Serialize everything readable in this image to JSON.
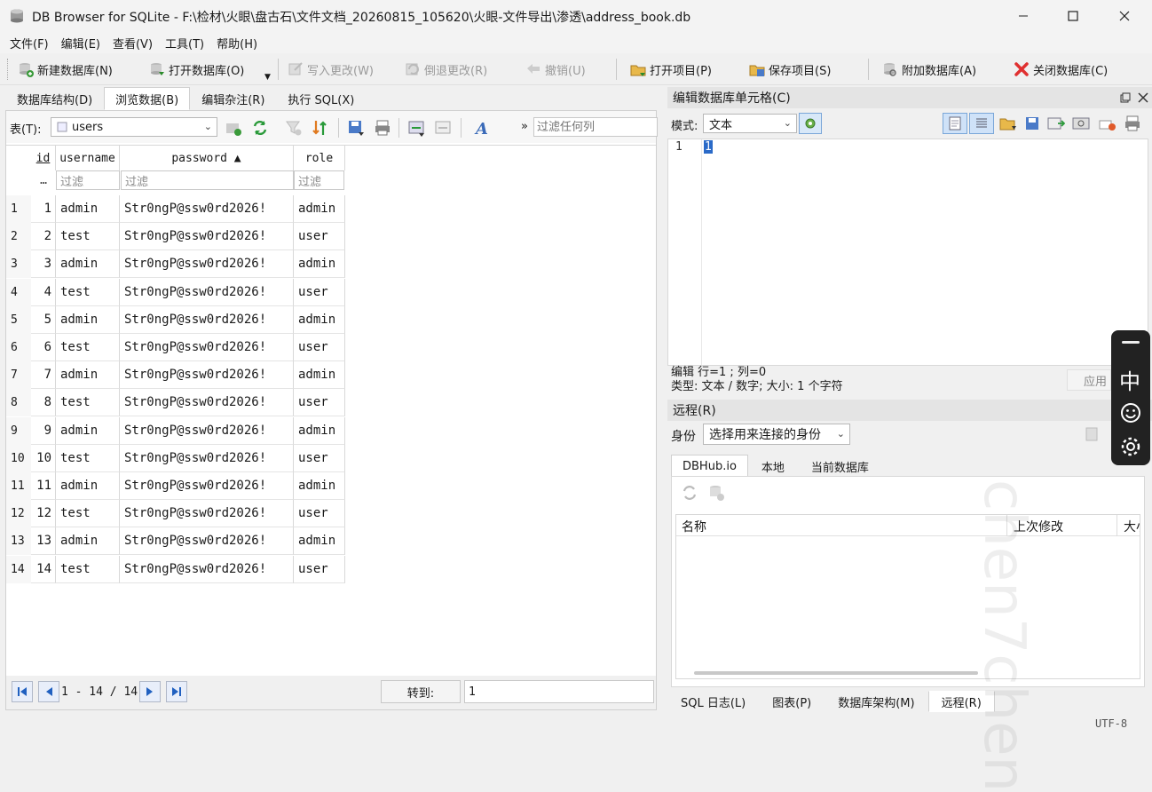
{
  "window": {
    "title": "DB Browser for SQLite - F:\\检材\\火眼\\盘古石\\文件文档_20260815_105620\\火眼-文件导出\\渗透\\address_book.db",
    "icon": "database-icon"
  },
  "menu": [
    "文件(F)",
    "编辑(E)",
    "查看(V)",
    "工具(T)",
    "帮助(H)"
  ],
  "toolbar": {
    "new_db": "新建数据库(N)",
    "open_db": "打开数据库(O)",
    "write_changes": "写入更改(W)",
    "revert_changes": "倒退更改(R)",
    "undo": "撤销(U)",
    "open_project": "打开项目(P)",
    "save_project": "保存项目(S)",
    "attach_db": "附加数据库(A)",
    "close_db": "关闭数据库(C)"
  },
  "left_tabs": [
    "数据库结构(D)",
    "浏览数据(B)",
    "编辑杂注(R)",
    "执行 SQL(X)"
  ],
  "browse": {
    "table_label": "表(T):",
    "table_name": "users",
    "more": "»",
    "filter_placeholder": "过滤任何列",
    "columns": [
      "id",
      "username",
      "password ▲",
      "role"
    ],
    "filter_label": "过滤",
    "filter_ellipsis": "…",
    "rows": [
      [
        "1",
        "1",
        "admin",
        "Str0ngP@ssw0rd2026!",
        "admin"
      ],
      [
        "2",
        "2",
        "test",
        "Str0ngP@ssw0rd2026!",
        "user"
      ],
      [
        "3",
        "3",
        "admin",
        "Str0ngP@ssw0rd2026!",
        "admin"
      ],
      [
        "4",
        "4",
        "test",
        "Str0ngP@ssw0rd2026!",
        "user"
      ],
      [
        "5",
        "5",
        "admin",
        "Str0ngP@ssw0rd2026!",
        "admin"
      ],
      [
        "6",
        "6",
        "test",
        "Str0ngP@ssw0rd2026!",
        "user"
      ],
      [
        "7",
        "7",
        "admin",
        "Str0ngP@ssw0rd2026!",
        "admin"
      ],
      [
        "8",
        "8",
        "test",
        "Str0ngP@ssw0rd2026!",
        "user"
      ],
      [
        "9",
        "9",
        "admin",
        "Str0ngP@ssw0rd2026!",
        "admin"
      ],
      [
        "10",
        "10",
        "test",
        "Str0ngP@ssw0rd2026!",
        "user"
      ],
      [
        "11",
        "11",
        "admin",
        "Str0ngP@ssw0rd2026!",
        "admin"
      ],
      [
        "12",
        "12",
        "test",
        "Str0ngP@ssw0rd2026!",
        "user"
      ],
      [
        "13",
        "13",
        "admin",
        "Str0ngP@ssw0rd2026!",
        "admin"
      ],
      [
        "14",
        "14",
        "test",
        "Str0ngP@ssw0rd2026!",
        "user"
      ]
    ],
    "pagination": "1 - 14 / 14",
    "goto_label": "转到:",
    "goto_value": "1"
  },
  "edit_cell": {
    "header": "编辑数据库单元格(C)",
    "mode_label": "模式:",
    "mode_value": "文本",
    "line_number": "1",
    "content": "1",
    "status_line1": "编辑 行=1 ; 列=0",
    "status_line2": "类型: 文本 / 数字; 大小: 1 个字符",
    "apply": "应用"
  },
  "remote": {
    "header": "远程(R)",
    "identity_label": "身份",
    "identity_value": "选择用来连接的身份",
    "tabs": [
      "DBHub.io",
      "本地",
      "当前数据库"
    ],
    "columns": [
      "名称",
      "上次修改",
      "大小"
    ]
  },
  "bottom_tabs": [
    "SQL 日志(L)",
    "图表(P)",
    "数据库架构(M)",
    "远程(R)"
  ],
  "encoding": "UTF-8",
  "ime": {
    "lang": "中"
  },
  "watermark": "chen7chen"
}
